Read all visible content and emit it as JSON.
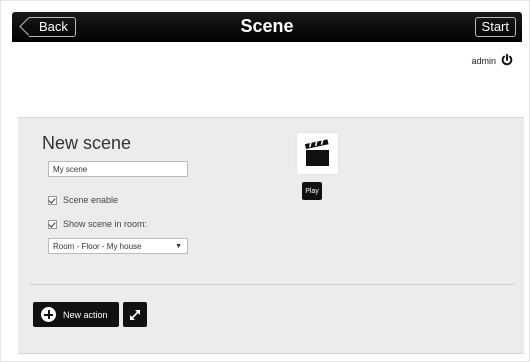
{
  "header": {
    "title": "Scene",
    "back_label": "Back",
    "start_label": "Start"
  },
  "user": {
    "name": "admin",
    "power_icon": "power-icon"
  },
  "scene": {
    "title": "New scene",
    "name_value": "My scene",
    "enable_label": "Scene enable",
    "enable_checked": true,
    "show_in_room_label": "Show scene in room:",
    "show_in_room_checked": true,
    "room_selected": "Room - Floor - My house",
    "icon": "clapperboard-icon",
    "play_label": "Play"
  },
  "actions": {
    "new_action_label": "New action",
    "new_action_icon": "plus-circle-icon",
    "expand_icon": "expand-icon"
  }
}
